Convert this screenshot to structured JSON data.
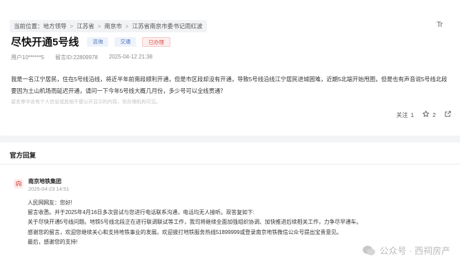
{
  "breadcrumb": {
    "prefix": "当前位置：",
    "items": [
      "地方领导",
      "江苏省",
      "南京市",
      "江苏省南京市委书记周红波"
    ],
    "separator": ">"
  },
  "font_size_toggle": "Tr",
  "post": {
    "title": "尽快开通5号线",
    "tags": [
      "咨询",
      "交通",
      "已办理"
    ],
    "user": "用户10******5",
    "message_id": "留言ID:22809978",
    "time": "2025-04-12 21:38",
    "content": "我是一名江宁居民，住在5号线沿线，将近半年前南段顺利开通，但是市区段却没有开通，导致5号线沿线江宁居民进城困难，近期5北端开始甩图，但是也有声音说5号线北段要因为土山机场而延迟开通，请问一下今年5号线大概几月份，多少号可以全线贯通？",
    "disclaimer": "留言审中含有个人信息或其他不便公开显示的内容，你办理机构可见。",
    "follow_label": "关注",
    "follow_count": "1",
    "like_count": "2"
  },
  "reply": {
    "heading": "官方回复",
    "org_name": "南京地铁集团",
    "date": "2025-04-23 14:51",
    "lines": [
      "人民网网友：您好!",
      "留言收悉。并于2025年4月16日多次尝试与您进行电话联系沟通，电话均无人接听。现答复如下:",
      "关于尽快开通5号线问题。地铁5号线北段正在进行联调联试等工作，我司将继续全面加强组织协调、加快推进后续相关工作，力争尽早通车。",
      "感谢您的留言，欢迎您继续关心和支持地铁事业的发展。欢迎拨打地铁服务热线51899999或登录南京地铁微信公众号提出宝贵意见。",
      "最后，感谢您的支持!"
    ]
  },
  "watermark": "公众号 · 西祠房产",
  "colors": {
    "accent_red": "#d9534f",
    "tag_blue": "#4a6fb8"
  }
}
